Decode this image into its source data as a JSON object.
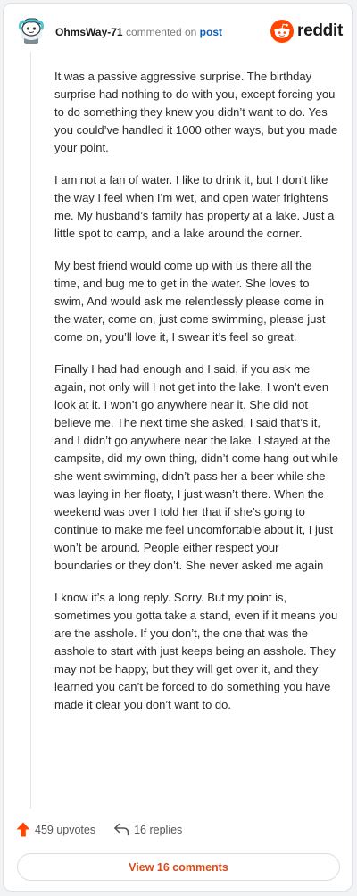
{
  "header": {
    "username": "OhmsWay-71",
    "action_text": "commented on",
    "post_link": "post",
    "brand": "reddit"
  },
  "comment": {
    "paragraphs": [
      "It was a passive aggressive surprise. The birthday surprise had nothing to do with you, except forcing you to do something they knew you didn’t want to do. Yes you could’ve handled it 1000 other ways, but you made your point.",
      "I am not a fan of water. I like to drink it, but I don’t like the way I feel when I’m wet, and open water frightens me. My husband’s family has property at a lake. Just a little spot to camp, and a lake around the corner.",
      "My best friend would come up with us there all the time, and bug me to get in the water. She loves to swim, And would ask me relentlessly please come in the water, come on, just come swimming, please just come on, you’ll love it, I swear it’s feel so great.",
      "Finally I had had enough and I said, if you ask me again, not only will I not get into the lake, I won’t even look at it. I won’t go anywhere near it. She did not believe me. The next time she asked, I said that’s it, and I didn’t go anywhere near the lake. I stayed at the campsite, did my own thing, didn’t come hang out while she went swimming, didn’t pass her a beer while she was laying in her floaty, I just wasn’t there. When the weekend was over I told her that if she’s going to continue to make me feel uncomfortable about it, I just won’t be around. People either respect your boundaries or they don’t. She never asked me again",
      "I know it’s a long reply. Sorry. But my point is, sometimes you gotta take a stand, even if it means you are the asshole. If you don’t, the one that was the asshole to start with just keeps being an asshole. They may not be happy, but they will get over it, and they learned you can’t be forced to do something you have made it clear you don’t want to do."
    ]
  },
  "footer": {
    "upvotes": "459 upvotes",
    "replies": "16 replies",
    "view_comments": "View 16 comments"
  },
  "colors": {
    "upvote_accent": "#ff4500",
    "link_blue": "#0b5fb5",
    "view_button_text": "#d94a16",
    "reddit_logo": "#ff4500"
  },
  "icons": {
    "avatar": "snoo-avatar-icon",
    "logo": "reddit-logo-icon",
    "upvote": "upvote-arrow-icon",
    "reply": "reply-arrow-icon"
  }
}
